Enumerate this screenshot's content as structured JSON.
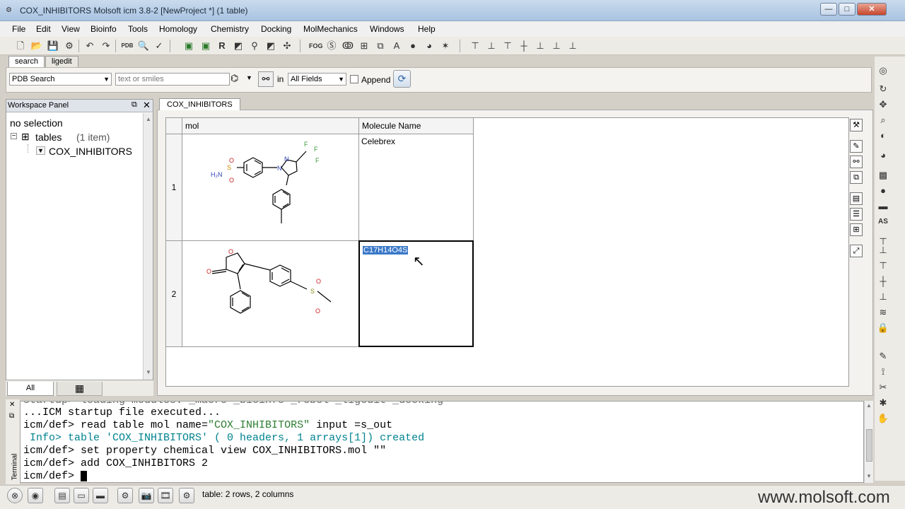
{
  "window": {
    "title": "COX_INHIBITORS Molsoft icm 3.8-2  [NewProject *] (1 table)",
    "minimize": "—",
    "maximize": "□",
    "close": "✕"
  },
  "menu": [
    "File",
    "Edit",
    "View",
    "Bioinfo",
    "Tools",
    "Homology",
    "Chemistry",
    "Docking",
    "MolMechanics",
    "Windows",
    "Help"
  ],
  "search": {
    "tabs": [
      "search",
      "ligedit"
    ],
    "source": "PDB Search",
    "placeholder": "text or smiles",
    "in_label": "in",
    "field": "All Fields",
    "append_label": "Append",
    "append_checked": false
  },
  "workspace": {
    "title": "Workspace Panel",
    "no_selection": "no selection",
    "tree": {
      "tables_label": "tables",
      "tables_count": "(1 item)",
      "item": "COX_INHIBITORS"
    },
    "tabs": [
      "All",
      "▦"
    ]
  },
  "document": {
    "tab": "COX_INHIBITORS",
    "columns": [
      "mol",
      "Molecule Name"
    ],
    "rows": [
      {
        "num": "1",
        "name": "Celebrex",
        "selected": false
      },
      {
        "num": "2",
        "name": "C17H14O4S",
        "selected": true
      }
    ],
    "mol_labels": {
      "r1": [
        "O",
        "H₂N",
        "S",
        "O",
        "N",
        "N",
        "F",
        "F",
        "F"
      ],
      "r2": [
        "O",
        "O",
        "S",
        "O",
        "O"
      ]
    }
  },
  "terminal": {
    "label": "Terminal",
    "lines": [
      "startup> loading modules: _macro _bioinfo _rebel _ligedit _docking",
      "...ICM startup file executed...",
      "icm/def> read table mol name=\"COX_INHIBITORS\" input =s_out",
      " Info> table 'COX_INHIBITORS' ( 0 headers, 1 arrays[1]) created",
      "icm/def> set property chemical view COX_INHIBITORS.mol \"\"",
      "icm/def> add COX_INHIBITORS 2",
      "icm/def> "
    ]
  },
  "status": {
    "text": "table: 2 rows, 2 columns",
    "watermark": "www.molsoft.com"
  },
  "colors": {
    "selection": "#3a78c8",
    "title_bar": "#b7cde6",
    "chem_red": "#cc2222",
    "chem_blue": "#2a3fb5",
    "chem_green": "#3a9a3a",
    "chem_olive": "#8a8a1a"
  }
}
